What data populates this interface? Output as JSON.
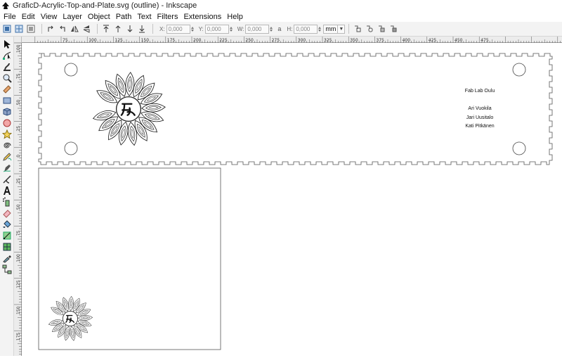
{
  "window": {
    "title": "GraficD-Acrylic-Top-and-Plate.svg (outline) - Inkscape"
  },
  "menubar": {
    "items": [
      "File",
      "Edit",
      "View",
      "Layer",
      "Object",
      "Path",
      "Text",
      "Filters",
      "Extensions",
      "Help"
    ]
  },
  "toolbar": {
    "x_label": "X:",
    "x_value": "0,000",
    "y_label": "Y:",
    "y_value": "0,000",
    "w_label": "W:",
    "w_value": "0,000",
    "lock_label": "a",
    "h_label": "H:",
    "h_value": "0,000",
    "unit": "mm"
  },
  "toolbox": {
    "tools": [
      "selector-tool-icon",
      "node-tool-icon",
      "tweak-tool-icon",
      "zoom-tool-icon",
      "measure-tool-icon",
      "rectangle-tool-icon",
      "3d-box-tool-icon",
      "ellipse-tool-icon",
      "star-tool-icon",
      "spiral-tool-icon",
      "pencil-tool-icon",
      "pen-tool-icon",
      "calligraphy-tool-icon",
      "text-tool-icon",
      "spray-tool-icon",
      "eraser-tool-icon",
      "paint-bucket-tool-icon",
      "gradient-tool-icon",
      "mesh-tool-icon",
      "dropper-tool-icon",
      "connector-tool-icon"
    ]
  },
  "ruler": {
    "h_labels": [
      "75",
      "100",
      "125",
      "150",
      "175",
      "200",
      "225",
      "250",
      "275",
      "300",
      "325",
      "350",
      "375",
      "400",
      "425",
      "450",
      "475"
    ],
    "v_labels": [
      "100",
      "75",
      "50",
      "25",
      "0",
      "25",
      "50",
      "75",
      "100",
      "125",
      "150",
      "175"
    ]
  },
  "canvas": {
    "credits": [
      "Fab Lab Oulu",
      "Ari Vuokila",
      "Jari Uusitalo",
      "Kati Pitkänen"
    ],
    "logo_text": "FK"
  }
}
